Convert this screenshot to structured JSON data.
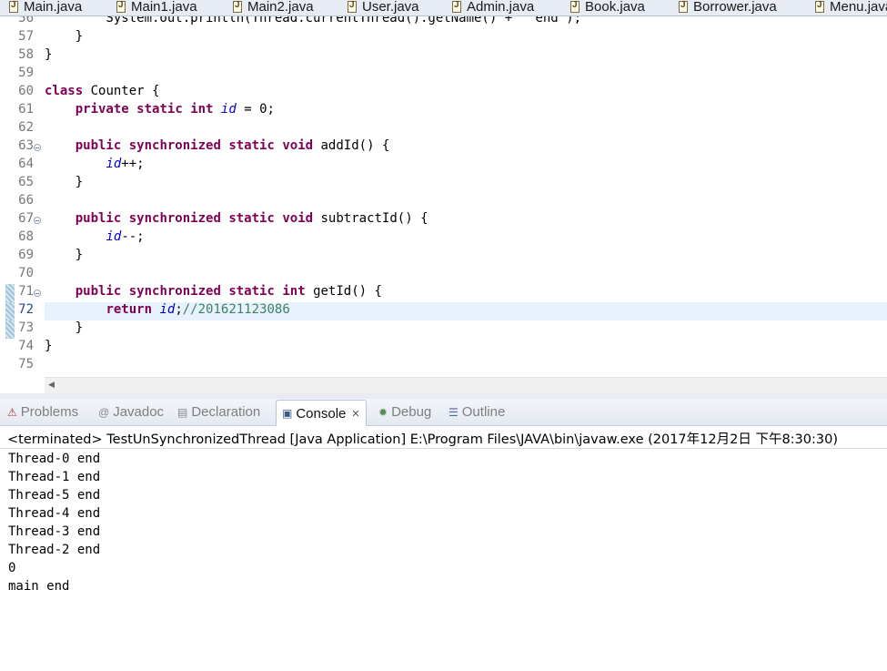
{
  "editor_tabs": [
    "Main.java",
    "Main1.java",
    "Main2.java",
    "User.java",
    "Admin.java",
    "Book.java",
    "Borrower.java",
    "Menu.java"
  ],
  "code": {
    "partial_line_text": "        System.out.println(Thread.currentThread().getName() + \" end\");",
    "lines": [
      {
        "n": "57",
        "text": "    }"
      },
      {
        "n": "58",
        "text": "}"
      },
      {
        "n": "59",
        "text": ""
      },
      {
        "n": "60",
        "text": "class Counter {"
      },
      {
        "n": "61",
        "text": "    private static int id = 0;"
      },
      {
        "n": "62",
        "text": ""
      },
      {
        "n": "63",
        "text": "    public synchronized static void addId() {"
      },
      {
        "n": "64",
        "text": "        id++;"
      },
      {
        "n": "65",
        "text": "    }"
      },
      {
        "n": "66",
        "text": ""
      },
      {
        "n": "67",
        "text": "    public synchronized static void subtractId() {"
      },
      {
        "n": "68",
        "text": "        id--;"
      },
      {
        "n": "69",
        "text": "    }"
      },
      {
        "n": "70",
        "text": ""
      },
      {
        "n": "71",
        "text": "    public synchronized static int getId() {"
      },
      {
        "n": "72",
        "text": "        return id;//201621123086"
      },
      {
        "n": "73",
        "text": "    }"
      },
      {
        "n": "74",
        "text": "}"
      },
      {
        "n": "75",
        "text": ""
      }
    ],
    "current_line": "72"
  },
  "panel_tabs": [
    {
      "label": "Problems",
      "icon": "problems-icon"
    },
    {
      "label": "Javadoc",
      "icon": "javadoc-icon"
    },
    {
      "label": "Declaration",
      "icon": "declaration-icon"
    },
    {
      "label": "Console",
      "icon": "console-icon",
      "active": true
    },
    {
      "label": "Debug",
      "icon": "debug-icon"
    },
    {
      "label": "Outline",
      "icon": "outline-icon"
    }
  ],
  "console": {
    "header": "<terminated> TestUnSynchronizedThread [Java Application] E:\\Program Files\\JAVA\\bin\\javaw.exe (2017年12月2日 下午8:30:30)",
    "output": [
      "Thread-0 end",
      "Thread-1 end",
      "Thread-5 end",
      "Thread-4 end",
      "Thread-3 end",
      "Thread-2 end",
      "0",
      "main end"
    ]
  },
  "colors": {
    "keyword": "#7f0055",
    "field": "#0000c0",
    "comment": "#3f7f5f",
    "current_line_bg": "#e8f2fe",
    "tab_bar_bg": "#e6ebf4"
  }
}
